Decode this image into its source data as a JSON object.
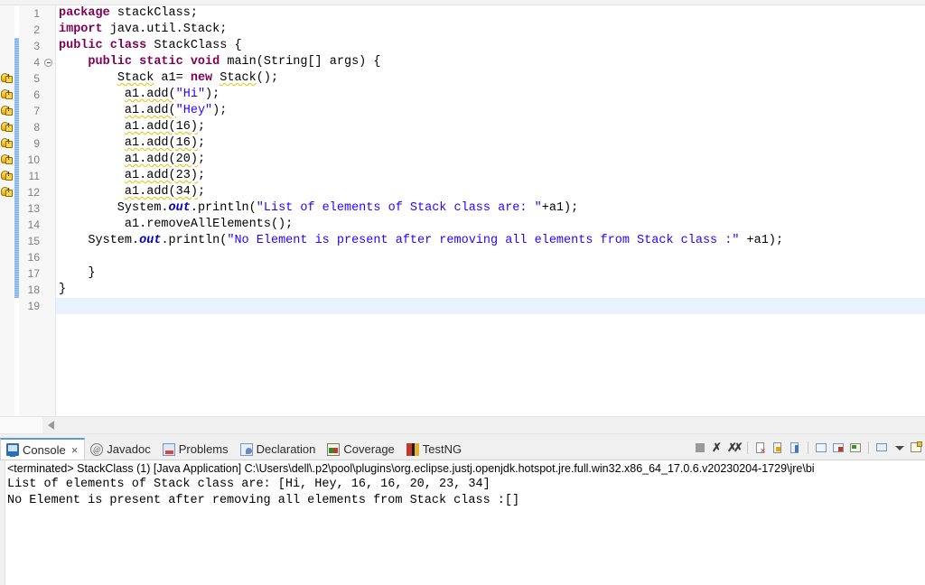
{
  "editor": {
    "lines": [
      {
        "num": "1",
        "warning": false,
        "fold": false,
        "changed": false,
        "tokens": [
          {
            "t": "package ",
            "c": "kw"
          },
          {
            "t": "stackClass;",
            "c": "plain"
          }
        ]
      },
      {
        "num": "2",
        "warning": false,
        "fold": false,
        "changed": false,
        "tokens": [
          {
            "t": "import ",
            "c": "kw"
          },
          {
            "t": "java.util.Stack;",
            "c": "plain"
          }
        ]
      },
      {
        "num": "3",
        "warning": false,
        "fold": false,
        "changed": true,
        "tokens": [
          {
            "t": "public class ",
            "c": "kw"
          },
          {
            "t": "StackClass {",
            "c": "plain"
          }
        ]
      },
      {
        "num": "4",
        "warning": false,
        "fold": true,
        "changed": true,
        "tokens": [
          {
            "t": "    ",
            "c": "plain"
          },
          {
            "t": "public static void ",
            "c": "kw"
          },
          {
            "t": "main(String[] args) {",
            "c": "plain"
          }
        ]
      },
      {
        "num": "5",
        "warning": true,
        "fold": false,
        "changed": true,
        "tokens": [
          {
            "t": "        ",
            "c": "plain"
          },
          {
            "t": "Stack",
            "c": "warnu"
          },
          {
            "t": " a1= ",
            "c": "plain"
          },
          {
            "t": "new ",
            "c": "kw"
          },
          {
            "t": "Stack",
            "c": "warnu"
          },
          {
            "t": "();",
            "c": "plain"
          }
        ]
      },
      {
        "num": "6",
        "warning": true,
        "fold": false,
        "changed": true,
        "tokens": [
          {
            "t": "         ",
            "c": "plain"
          },
          {
            "t": "a1.add(",
            "c": "warnu"
          },
          {
            "t": "\"Hi\"",
            "c": "str"
          },
          {
            "t": ");",
            "c": "plain"
          }
        ]
      },
      {
        "num": "7",
        "warning": true,
        "fold": false,
        "changed": true,
        "tokens": [
          {
            "t": "         ",
            "c": "plain"
          },
          {
            "t": "a1.add(",
            "c": "warnu"
          },
          {
            "t": "\"Hey\"",
            "c": "str"
          },
          {
            "t": ");",
            "c": "plain"
          }
        ]
      },
      {
        "num": "8",
        "warning": true,
        "fold": false,
        "changed": true,
        "tokens": [
          {
            "t": "         ",
            "c": "plain"
          },
          {
            "t": "a1.add(16)",
            "c": "warnu"
          },
          {
            "t": ";",
            "c": "plain"
          }
        ]
      },
      {
        "num": "9",
        "warning": true,
        "fold": false,
        "changed": true,
        "tokens": [
          {
            "t": "         ",
            "c": "plain"
          },
          {
            "t": "a1.add(16)",
            "c": "warnu"
          },
          {
            "t": ";",
            "c": "plain"
          }
        ]
      },
      {
        "num": "10",
        "warning": true,
        "fold": false,
        "changed": true,
        "tokens": [
          {
            "t": "         ",
            "c": "plain"
          },
          {
            "t": "a1.add(20)",
            "c": "warnu"
          },
          {
            "t": ";",
            "c": "plain"
          }
        ]
      },
      {
        "num": "11",
        "warning": true,
        "fold": false,
        "changed": true,
        "tokens": [
          {
            "t": "         ",
            "c": "plain"
          },
          {
            "t": "a1.add(23)",
            "c": "warnu"
          },
          {
            "t": ";",
            "c": "plain"
          }
        ]
      },
      {
        "num": "12",
        "warning": true,
        "fold": false,
        "changed": true,
        "tokens": [
          {
            "t": "         ",
            "c": "plain"
          },
          {
            "t": "a1.add(34)",
            "c": "warnu"
          },
          {
            "t": ";",
            "c": "plain"
          }
        ]
      },
      {
        "num": "13",
        "warning": false,
        "fold": false,
        "changed": true,
        "tokens": [
          {
            "t": "        System.",
            "c": "plain"
          },
          {
            "t": "out",
            "c": "fld"
          },
          {
            "t": ".println(",
            "c": "plain"
          },
          {
            "t": "\"List of elements of Stack class are: \"",
            "c": "str"
          },
          {
            "t": "+a1);",
            "c": "plain"
          }
        ]
      },
      {
        "num": "14",
        "warning": false,
        "fold": false,
        "changed": true,
        "tokens": [
          {
            "t": "         a1.removeAllElements();",
            "c": "plain"
          }
        ]
      },
      {
        "num": "15",
        "warning": false,
        "fold": false,
        "changed": true,
        "tokens": [
          {
            "t": "    System.",
            "c": "plain"
          },
          {
            "t": "out",
            "c": "fld"
          },
          {
            "t": ".println(",
            "c": "plain"
          },
          {
            "t": "\"No Element is present after removing all elements from Stack class :\"",
            "c": "str"
          },
          {
            "t": " +a1);",
            "c": "plain"
          }
        ]
      },
      {
        "num": "16",
        "warning": false,
        "fold": false,
        "changed": true,
        "tokens": []
      },
      {
        "num": "17",
        "warning": false,
        "fold": false,
        "changed": true,
        "tokens": [
          {
            "t": "    }",
            "c": "plain"
          }
        ]
      },
      {
        "num": "18",
        "warning": false,
        "fold": false,
        "changed": true,
        "tokens": [
          {
            "t": "}",
            "c": "plain"
          }
        ]
      },
      {
        "num": "19",
        "warning": false,
        "fold": false,
        "changed": false,
        "current": true,
        "tokens": []
      }
    ]
  },
  "console_view": {
    "tabs": [
      {
        "label": "Console",
        "icon": "console-icon",
        "active": true,
        "closable": true
      },
      {
        "label": "Javadoc",
        "icon": "javadoc-icon",
        "active": false,
        "closable": false
      },
      {
        "label": "Problems",
        "icon": "problems-icon",
        "active": false,
        "closable": false
      },
      {
        "label": "Declaration",
        "icon": "declaration-icon",
        "active": false,
        "closable": false
      },
      {
        "label": "Coverage",
        "icon": "coverage-icon",
        "active": false,
        "closable": false
      },
      {
        "label": "TestNG",
        "icon": "testng-icon",
        "active": false,
        "closable": false
      }
    ],
    "close_glyph": "×",
    "toolbar": [
      {
        "name": "terminate-button",
        "icon": "stop-icon"
      },
      {
        "name": "remove-launch-button",
        "icon": "x-icon"
      },
      {
        "name": "remove-all-terminated-button",
        "icon": "xx-icon"
      },
      {
        "name": "clear-console-button",
        "icon": "clear-console-icon"
      },
      {
        "name": "scroll-lock-button",
        "icon": "lock-icon"
      },
      {
        "name": "pin-console-button",
        "icon": "pin-icon"
      },
      {
        "name": "display-selected-console-button",
        "icon": "display-console-icon"
      },
      {
        "name": "show-console-on-output-button",
        "icon": "show-console-icon"
      },
      {
        "name": "open-console-button",
        "icon": "open-console-icon"
      },
      {
        "name": "view-menu-button",
        "icon": "monitor-icon"
      },
      {
        "name": "view-menu-dropdown",
        "icon": "chevron-down-icon"
      },
      {
        "name": "new-console-view-button",
        "icon": "new-console-icon"
      }
    ],
    "terminated_line": "<terminated> StackClass (1) [Java Application] C:\\Users\\dell\\.p2\\pool\\plugins\\org.eclipse.justj.openjdk.hotspot.jre.full.win32.x86_64_17.0.6.v20230204-1729\\jre\\bi",
    "output": [
      "List of elements of Stack class are: [Hi, Hey, 16, 16, 20, 23, 34]",
      "No Element is present after removing all elements from Stack class :[]"
    ]
  },
  "colors": {
    "keyword": "#7f0055",
    "string": "#2a00ff",
    "static_field": "#0000c0",
    "line_number": "#808080",
    "change_bar": "#6aa6e8",
    "current_line": "#e8f2fe",
    "warning_underline": "#e6c200",
    "active_tab_border": "#5a9ad6"
  }
}
